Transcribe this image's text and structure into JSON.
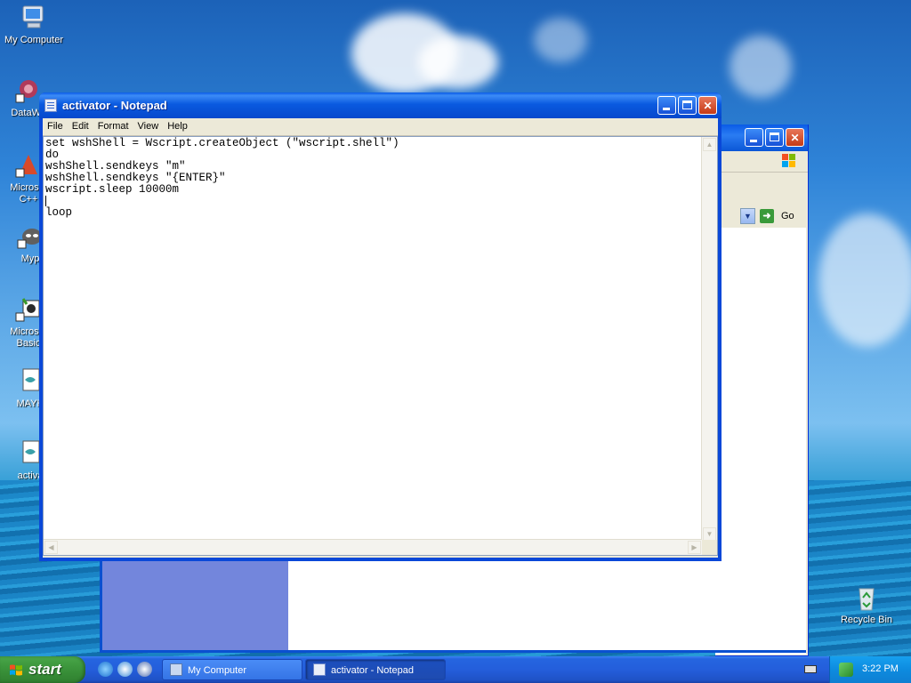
{
  "desktop": {
    "icons": [
      {
        "label": "My Computer"
      },
      {
        "label": "DataWa"
      },
      {
        "label": "Microsof"
      },
      {
        "label": "C++"
      },
      {
        "label": "Myp"
      },
      {
        "label": "Microsof"
      },
      {
        "label": "Basic"
      },
      {
        "label": "MAYH"
      },
      {
        "label": "activa"
      },
      {
        "label": "Recycle Bin"
      }
    ]
  },
  "background_window": {
    "go_label": "Go"
  },
  "notepad": {
    "title": "activator - Notepad",
    "menu": [
      "File",
      "Edit",
      "Format",
      "View",
      "Help"
    ],
    "lines": [
      "set wshShell = Wscript.createObject (\"wscript.shell\")",
      "do",
      "wshShell.sendkeys \"m\"",
      "wshShell.sendkeys \"{ENTER}\"",
      "wscript.sleep 10000m",
      "",
      "loop"
    ]
  },
  "taskbar": {
    "start_label": "start",
    "tasks": [
      {
        "label": "My Computer"
      },
      {
        "label": "activator - Notepad"
      }
    ],
    "clock": "3:22 PM"
  },
  "colors": {
    "title_blue": "#0a5ae0",
    "start_green": "#3c963c",
    "close_red": "#c53a16"
  }
}
